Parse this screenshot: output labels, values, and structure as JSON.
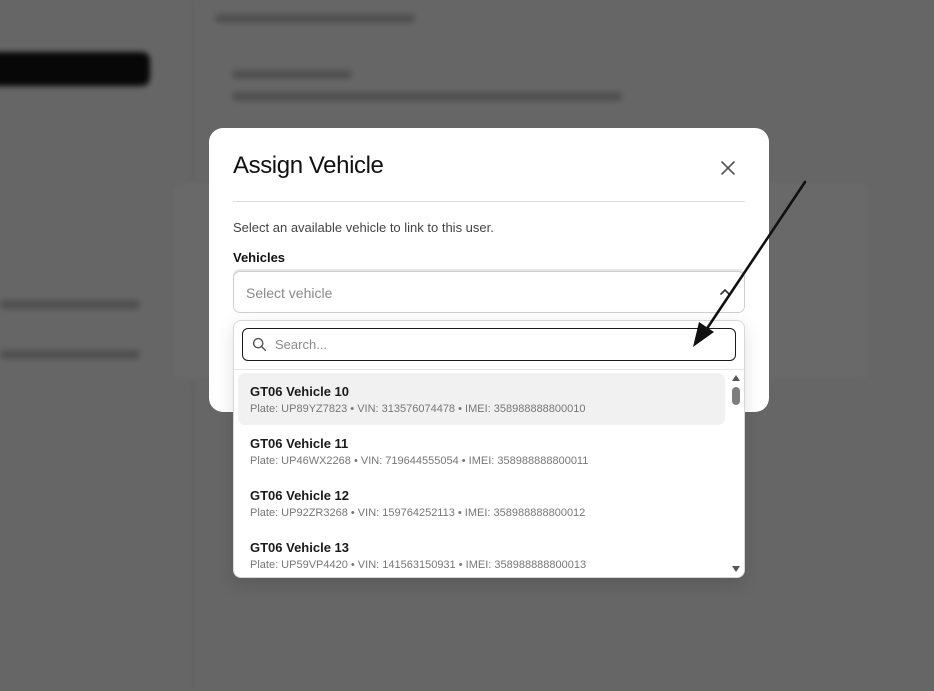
{
  "modal": {
    "title": "Assign Vehicle",
    "description": "Select an available vehicle to link to this user.",
    "field_label": "Vehicles",
    "select_placeholder": "Select vehicle",
    "close_icon": "close-icon"
  },
  "dropdown": {
    "search_placeholder": "Search...",
    "search_value": "",
    "items": [
      {
        "title": "GT06 Vehicle 10",
        "subtitle": "Plate: UP89YZ7823 • VIN: 313576074478 • IMEI: 358988888800010"
      },
      {
        "title": "GT06 Vehicle 11",
        "subtitle": "Plate: UP46WX2268 • VIN: 719644555054 • IMEI: 358988888800011"
      },
      {
        "title": "GT06 Vehicle 12",
        "subtitle": "Plate: UP92ZR3268 • VIN: 159764252113 • IMEI: 358988888800012"
      },
      {
        "title": "GT06 Vehicle 13",
        "subtitle": "Plate: UP59VP4420 • VIN: 141563150931 • IMEI: 358988888800013"
      }
    ]
  },
  "icons": {
    "search": "search-icon",
    "chevron": "chevron-up-icon",
    "annotation": "arrow-icon"
  },
  "colors": {
    "overlay": "#000000",
    "highlight": "#f1f1f1",
    "text_primary": "#111111",
    "text_muted": "#777777"
  }
}
